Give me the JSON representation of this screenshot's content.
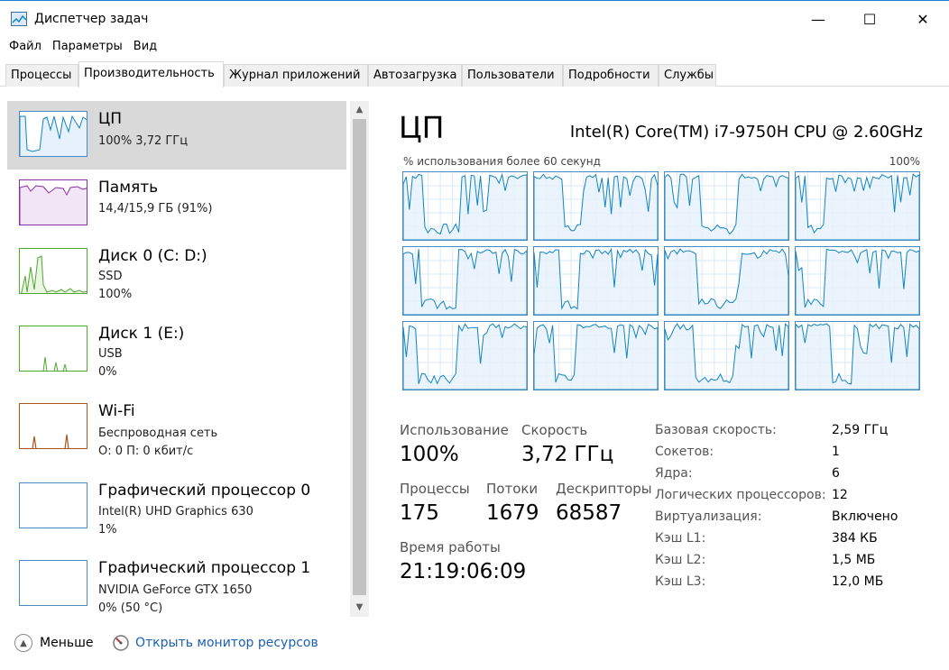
{
  "window": {
    "title": "Диспетчер задач",
    "minimize": "—",
    "maximize": "☐",
    "close": "✕"
  },
  "menu": [
    "Файл",
    "Параметры",
    "Вид"
  ],
  "tabs": [
    "Процессы",
    "Производительность",
    "Журнал приложений",
    "Автозагрузка",
    "Пользователи",
    "Подробности",
    "Службы"
  ],
  "sidebar": {
    "items": [
      {
        "name": "ЦП",
        "sub1": "100%  3,72 ГГц",
        "sub2": "",
        "color": "#1183c3"
      },
      {
        "name": "Память",
        "sub1": "14,4/15,9 ГБ (91%)",
        "sub2": "",
        "color": "#8b2fa8"
      },
      {
        "name": "Диск 0 (C: D:)",
        "sub1": "SSD",
        "sub2": "100%",
        "color": "#4ea72e"
      },
      {
        "name": "Диск 1 (E:)",
        "sub1": "USB",
        "sub2": "0%",
        "color": "#4ea72e"
      },
      {
        "name": "Wi-Fi",
        "sub1": "Беспроводная сеть",
        "sub2": "О: 0  П: 0 кбит/с",
        "color": "#a7541d"
      },
      {
        "name": "Графический процессор 0",
        "sub1": "Intel(R) UHD Graphics 630",
        "sub2": "1%",
        "color": "#1183c3"
      },
      {
        "name": "Графический процессор 1",
        "sub1": "NVIDIA GeForce GTX 1650",
        "sub2": "0%  (50 °C)",
        "color": "#1183c3"
      }
    ]
  },
  "cpu": {
    "title": "ЦП",
    "model": "Intel(R) Core(TM) i7-9750H CPU @ 2.60GHz",
    "graph_caption": "% использования более 60 секунд",
    "graph_max": "100%",
    "cores": 12,
    "accent": "#1183c3",
    "stats": {
      "usage_label": "Использование",
      "usage_value": "100%",
      "speed_label": "Скорость",
      "speed_value": "3,72 ГГц",
      "processes_label": "Процессы",
      "processes_value": "175",
      "threads_label": "Потоки",
      "threads_value": "1679",
      "handles_label": "Дескрипторы",
      "handles_value": "68587",
      "uptime_label": "Время работы",
      "uptime_value": "21:19:06:09"
    },
    "specs": [
      {
        "label": "Базовая скорость:",
        "value": "2,59 ГГц"
      },
      {
        "label": "Сокетов:",
        "value": "1"
      },
      {
        "label": "Ядра:",
        "value": "6"
      },
      {
        "label": "Логических процессоров:",
        "value": "12"
      },
      {
        "label": "Виртуализация:",
        "value": "Включено"
      },
      {
        "label": "Кэш L1:",
        "value": "384 КБ"
      },
      {
        "label": "Кэш L2:",
        "value": "1,5 МБ"
      },
      {
        "label": "Кэш L3:",
        "value": "12,0 МБ"
      }
    ]
  },
  "footer": {
    "less": "Меньше",
    "monitor": "Открыть монитор ресурсов"
  }
}
